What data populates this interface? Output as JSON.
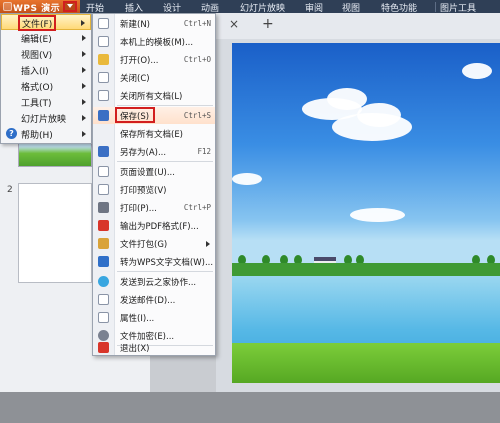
{
  "app": {
    "title": "WPS 演示"
  },
  "ribbon": {
    "tabs": [
      "开始",
      "插入",
      "设计",
      "动画",
      "幻灯片放映",
      "审阅",
      "视图",
      "特色功能",
      "图片工具"
    ]
  },
  "main_menu": {
    "items": [
      {
        "label": "文件(F)",
        "has_submenu": true
      },
      {
        "label": "编辑(E)",
        "has_submenu": true
      },
      {
        "label": "视图(V)",
        "has_submenu": true
      },
      {
        "label": "插入(I)",
        "has_submenu": true
      },
      {
        "label": "格式(O)",
        "has_submenu": true
      },
      {
        "label": "工具(T)",
        "has_submenu": true
      },
      {
        "label": "幻灯片放映",
        "has_submenu": true
      },
      {
        "label": "帮助(H)",
        "has_submenu": true
      }
    ]
  },
  "file_submenu": {
    "items": [
      {
        "label": "新建(N)",
        "shortcut": "Ctrl+N",
        "icon": "new-doc-icon"
      },
      {
        "label": "本机上的模板(M)...",
        "shortcut": "",
        "icon": "template-icon"
      },
      {
        "label": "打开(O)...",
        "shortcut": "Ctrl+O",
        "icon": "open-folder-icon"
      },
      {
        "label": "关闭(C)",
        "shortcut": "",
        "icon": "close-doc-icon"
      },
      {
        "label": "关闭所有文档(L)",
        "shortcut": "",
        "icon": "close-all-icon"
      },
      {
        "label": "保存(S)",
        "shortcut": "Ctrl+S",
        "icon": "save-icon"
      },
      {
        "label": "保存所有文档(E)",
        "shortcut": "",
        "icon": ""
      },
      {
        "label": "另存为(A)...",
        "shortcut": "F12",
        "icon": "save-as-icon"
      },
      {
        "label": "页面设置(U)...",
        "shortcut": "",
        "icon": "page-setup-icon"
      },
      {
        "label": "打印预览(V)",
        "shortcut": "",
        "icon": "print-preview-icon"
      },
      {
        "label": "打印(P)...",
        "shortcut": "Ctrl+P",
        "icon": "print-icon"
      },
      {
        "label": "输出为PDF格式(F)...",
        "shortcut": "",
        "icon": "pdf-icon"
      },
      {
        "label": "文件打包(G)",
        "shortcut": "",
        "icon": "package-icon"
      },
      {
        "label": "转为WPS文字文档(W)...",
        "shortcut": "",
        "icon": "convert-icon"
      },
      {
        "label": "发送到云之家协作...",
        "shortcut": "",
        "icon": "cloud-icon"
      },
      {
        "label": "发送邮件(D)...",
        "shortcut": "",
        "icon": "mail-icon"
      },
      {
        "label": "属性(I)...",
        "shortcut": "",
        "icon": "properties-icon"
      },
      {
        "label": "文件加密(E)...",
        "shortcut": "",
        "icon": "encrypt-icon"
      },
      {
        "label": "退出(X)",
        "shortcut": "",
        "icon": "exit-icon"
      }
    ]
  },
  "slide_panel": {
    "second_slide_number": "2"
  },
  "editor": {
    "tab_close_glyph": "×",
    "tab_add_glyph": "+"
  },
  "colors": {
    "ribbon_bg": "#2f3f56",
    "wps_brand": "#d9662a",
    "highlight_box": "#d21e1e",
    "selected_item": "#ffe1cc"
  }
}
